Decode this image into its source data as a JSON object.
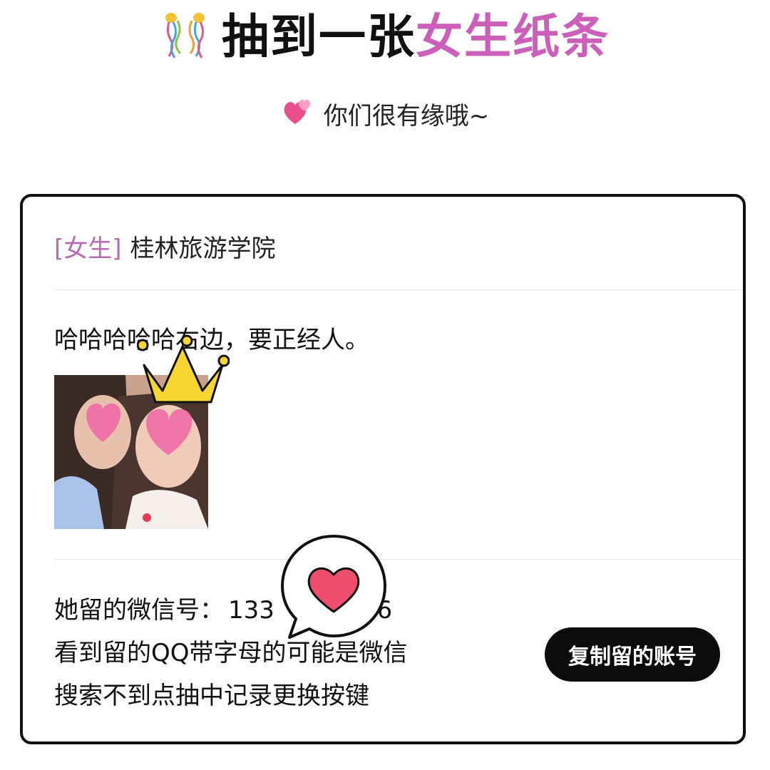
{
  "header": {
    "title_prefix": "抽到一张",
    "title_highlight": "女生纸条",
    "title_icon": "confetti-party-popper-icon",
    "accent_color": "#cc5fb9"
  },
  "subtitle": {
    "icon": "two-hearts-icon",
    "text": "你们很有缘哦~"
  },
  "card": {
    "gender_tag": "[女生]",
    "school": "桂林旅游学院",
    "message": "哈哈哈哈哈右边，要正经人。",
    "photo_icon": "profile-photo-with-heart-stickers",
    "crown_icon": "crown-sticker-icon",
    "contact": {
      "wechat_label": "她留的微信号：",
      "wechat_value_visible_start": "133",
      "wechat_value_visible_end": "16",
      "mask_icon": "heart-speech-bubble-icon",
      "note_line_1": "看到留的QQ带字母的可能是微信",
      "note_line_2": "搜索不到点抽中记录更换按键"
    },
    "copy_button_label": "复制留的账号",
    "button_color": "#0b0b0b"
  }
}
